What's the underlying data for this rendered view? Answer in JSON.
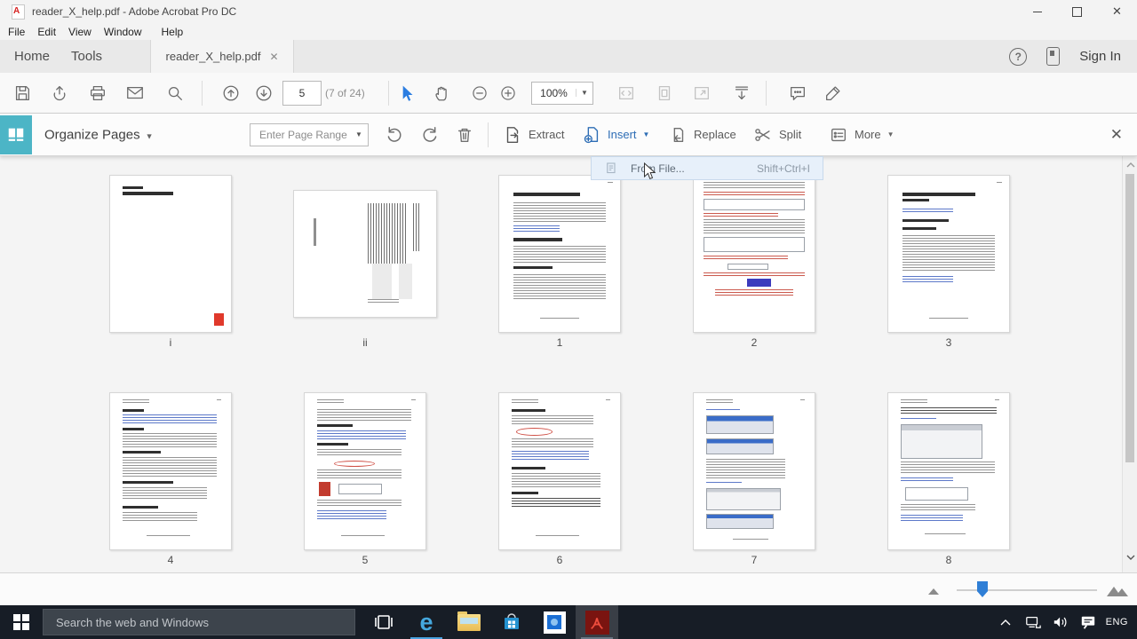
{
  "window": {
    "title": "reader_X_help.pdf - Adobe Acrobat Pro DC",
    "menu": [
      "File",
      "Edit",
      "View",
      "Window",
      "Help"
    ]
  },
  "nav": {
    "home": "Home",
    "tools": "Tools",
    "document_tab": "reader_X_help.pdf",
    "sign_in": "Sign In"
  },
  "toolbar": {
    "page_number": "5",
    "page_info": "(7 of 24)",
    "zoom_value": "100%"
  },
  "organize": {
    "title": "Organize Pages",
    "range_placeholder": "Enter Page Range",
    "extract": "Extract",
    "insert": "Insert",
    "replace": "Replace",
    "split": "Split",
    "more": "More"
  },
  "insert_menu": {
    "from_file": "From File...",
    "shortcut": "Shift+Ctrl+I"
  },
  "thumbnails": [
    {
      "label": "i",
      "type": "cover"
    },
    {
      "label": "ii",
      "type": "toc"
    },
    {
      "label": "1",
      "type": "p1"
    },
    {
      "label": "2",
      "type": "p2"
    },
    {
      "label": "3",
      "type": "p3"
    },
    {
      "label": "4",
      "type": "p4"
    },
    {
      "label": "5",
      "type": "p5"
    },
    {
      "label": "6",
      "type": "p6"
    },
    {
      "label": "7",
      "type": "p7"
    },
    {
      "label": "8",
      "type": "p8"
    }
  ],
  "taskbar": {
    "search_placeholder": "Search the web and Windows",
    "language": "ENG"
  },
  "icons": {
    "toolbar": [
      "save",
      "share-upload",
      "print",
      "email",
      "search",
      "page-up",
      "page-down",
      "select-tool",
      "hand-tool",
      "zoom-out",
      "zoom-in",
      "fit-width",
      "fit-page",
      "fullscreen",
      "scrolling-mode",
      "comment",
      "highlight"
    ],
    "organize": [
      "organize-pages",
      "rotate-left",
      "rotate-right",
      "delete",
      "extract",
      "insert",
      "replace",
      "split",
      "more",
      "close"
    ],
    "taskbar": [
      "windows-start",
      "task-view",
      "edge",
      "file-explorer",
      "store",
      "photos",
      "acrobat",
      "tray-expand",
      "network",
      "volume",
      "notifications"
    ]
  },
  "colors": {
    "teal_accent": "#4cb5c6",
    "insert_blue": "#2d6db5",
    "selection_blue": "#2b7de1",
    "taskbar_bg": "#171d26"
  }
}
